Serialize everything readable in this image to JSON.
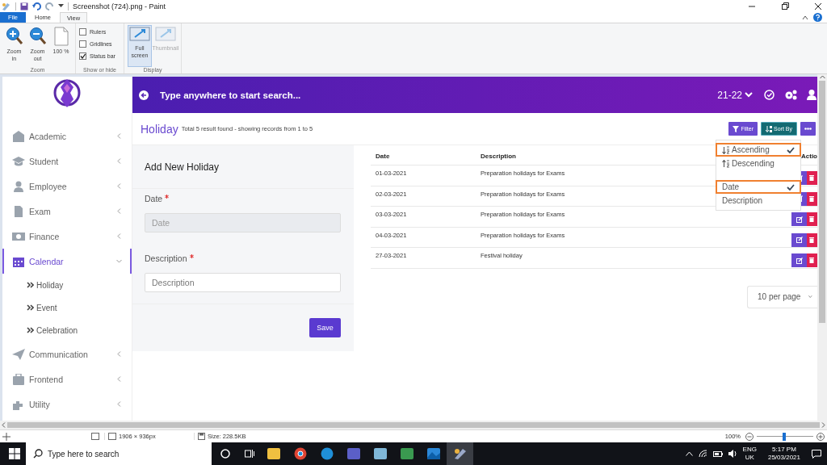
{
  "paint": {
    "title": "Screenshot (724).png - Paint",
    "ribbon_tabs": [
      {
        "label": "File",
        "kind": "file",
        "selected": false
      },
      {
        "label": "Home",
        "kind": "tab",
        "selected": false
      },
      {
        "label": "View",
        "kind": "tab",
        "selected": true
      }
    ],
    "zoom_group": {
      "label": "Zoom",
      "buttons": [
        "Zoom in",
        "Zoom out",
        "100 %"
      ]
    },
    "show_hide_group": {
      "label": "Show or hide",
      "options": [
        {
          "label": "Rulers",
          "checked": false
        },
        {
          "label": "Gridlines",
          "checked": false
        },
        {
          "label": "Status bar",
          "checked": true
        }
      ]
    },
    "display_group": {
      "label": "Display",
      "buttons": [
        {
          "label": "Full screen",
          "selected": true,
          "disabled": false
        },
        {
          "label": "Thumbnail",
          "selected": false,
          "disabled": true
        }
      ]
    },
    "status_bar": {
      "dimensions": "1906 × 936px",
      "size": "Size: 228.5KB",
      "zoom": "100%",
      "zoom_level": {
        "level": 0.48
      }
    }
  },
  "app": {
    "search": {
      "placeholder": "Type anywhere to start search..."
    },
    "session": "21-22",
    "sidebar": [
      {
        "label": "Academic",
        "selected": false,
        "expanded": false
      },
      {
        "label": "Student",
        "selected": false,
        "expanded": false
      },
      {
        "label": "Employee",
        "selected": false,
        "expanded": false
      },
      {
        "label": "Exam",
        "selected": false,
        "expanded": false
      },
      {
        "label": "Finance",
        "selected": false,
        "expanded": false
      },
      {
        "label": "Calendar",
        "selected": true,
        "expanded": true,
        "children": [
          {
            "label": "Holiday",
            "selected": false
          },
          {
            "label": "Event",
            "selected": false
          },
          {
            "label": "Celebration",
            "selected": false
          }
        ]
      },
      {
        "label": "Communication",
        "selected": false,
        "expanded": false
      },
      {
        "label": "Frontend",
        "selected": false,
        "expanded": false
      },
      {
        "label": "Utility",
        "selected": false,
        "expanded": false
      }
    ],
    "page_title": "Holiday",
    "page_subtitle": "Total 5 result found - showing records from 1 to 5",
    "toolbar": {
      "filter": "Filter",
      "sort_by": "Sort By"
    },
    "form": {
      "title": "Add New Holiday",
      "fields": [
        {
          "label": "Date",
          "required": true,
          "placeholder": "Date",
          "disabled": true
        },
        {
          "label": "Description",
          "required": true,
          "placeholder": "Description",
          "disabled": false
        }
      ],
      "save": "Save"
    },
    "table": {
      "columns": [
        "Date",
        "Description",
        "Actio"
      ],
      "rows": [
        {
          "date": "01-03-2021",
          "description": "Preparation holidays for Exams"
        },
        {
          "date": "02-03-2021",
          "description": "Preparation holidays for Exams"
        },
        {
          "date": "03-03-2021",
          "description": "Preparation holidays for Exams"
        },
        {
          "date": "04-03-2021",
          "description": "Preparation holidays for Exams"
        },
        {
          "date": "27-03-2021",
          "description": "Festival holiday"
        }
      ]
    },
    "sort_menu": {
      "order_options": [
        {
          "label": "Ascending",
          "kind": "ascending",
          "checked": true,
          "highlighted": true
        },
        {
          "label": "Descending",
          "kind": "descending",
          "checked": false,
          "highlighted": false
        }
      ],
      "field_options": [
        {
          "label": "Date",
          "checked": true,
          "highlighted": true
        },
        {
          "label": "Description",
          "checked": false,
          "highlighted": false
        }
      ]
    },
    "per_page": "10 per page"
  },
  "taskbar": {
    "search_placeholder": "Type here to search",
    "apps": [
      {
        "active": false
      },
      {
        "active": false
      },
      {
        "active": false
      },
      {
        "active": false
      },
      {
        "active": false
      },
      {
        "active": false
      },
      {
        "active": false
      },
      {
        "active": true
      }
    ],
    "language": "ENG",
    "region": "UK",
    "time": "5:17 PM",
    "date": "25/03/2021"
  }
}
